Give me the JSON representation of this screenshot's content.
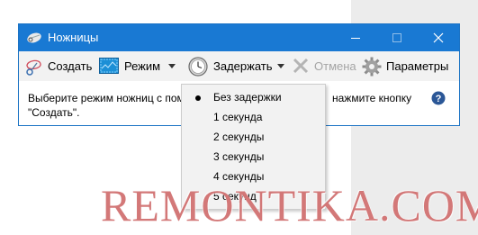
{
  "window": {
    "title": "Ножницы",
    "accent_color": "#1979d3",
    "controls": {
      "minimize_icon": "minimize-icon",
      "maximize_icon": "maximize-icon",
      "close_icon": "close-icon"
    }
  },
  "toolbar": {
    "new": {
      "label": "Создать",
      "icon": "scissors-icon"
    },
    "mode": {
      "label": "Режим",
      "icon": "mode-icon"
    },
    "delay": {
      "label": "Задержать",
      "icon": "clock-icon"
    },
    "cancel": {
      "label": "Отмена",
      "icon": "cancel-x-icon",
      "disabled": true
    },
    "options": {
      "label": "Параметры",
      "icon": "gear-icon"
    }
  },
  "message": {
    "line1_left": "Выберите режим ножниц с пом",
    "line1_right": "нажмите кнопку",
    "line2": "\"Создать\"."
  },
  "help_icon": "help-icon",
  "delay_menu": {
    "selected_index": 0,
    "items": [
      "Без задержки",
      "1 секунда",
      "2 секунды",
      "3 секунды",
      "4 секунды",
      "5 секунд"
    ]
  },
  "watermark": "REMONTIKA.COM"
}
